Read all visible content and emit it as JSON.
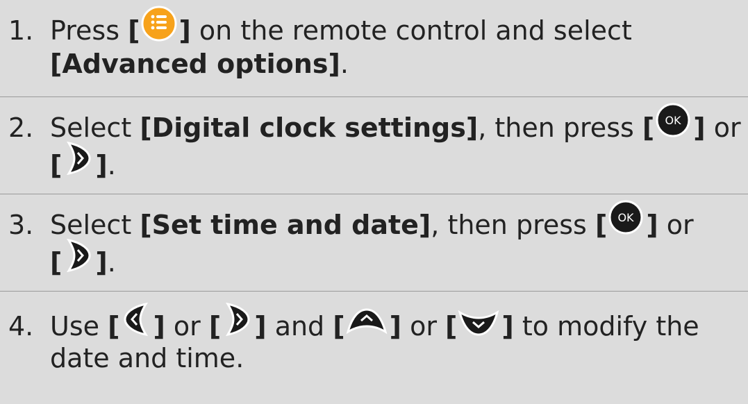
{
  "steps": [
    {
      "number": "1.",
      "text_a": "Press ",
      "bracket_open": "[",
      "bracket_close": "]",
      "text_b": " on the remote control and select",
      "bold_a": "[Advanced options]",
      "text_c": ".",
      "icons": [
        "menu-icon"
      ]
    },
    {
      "number": "2.",
      "text_a": "Select ",
      "bold_a": "[Digital clock settings]",
      "text_b": ", then press ",
      "bracket_open": "[",
      "bracket_close": "]",
      "text_c": " or",
      "text_d": ".",
      "icons": [
        "ok-icon",
        "right-arrow-icon"
      ]
    },
    {
      "number": "3.",
      "text_a": "Select ",
      "bold_a": "[Set time and date]",
      "text_b": ", then press ",
      "bracket_open": "[",
      "bracket_close": "]",
      "text_c": " or",
      "text_d": ".",
      "icons": [
        "ok-icon",
        "right-arrow-icon"
      ]
    },
    {
      "number": "4.",
      "text_a": "Use ",
      "bracket_open": "[",
      "bracket_close": "]",
      "text_or": " or ",
      "text_and": " and ",
      "text_b": " to modify the",
      "text_c": "date and time.",
      "icons": [
        "left-arrow-icon",
        "right-arrow-icon",
        "up-arrow-icon",
        "down-arrow-icon"
      ]
    }
  ],
  "colors": {
    "background": "#dcdcdc",
    "divider": "#9a9a9a",
    "text": "#222222",
    "menu_icon": "#f7a21b",
    "button": "#1a1a1a"
  }
}
